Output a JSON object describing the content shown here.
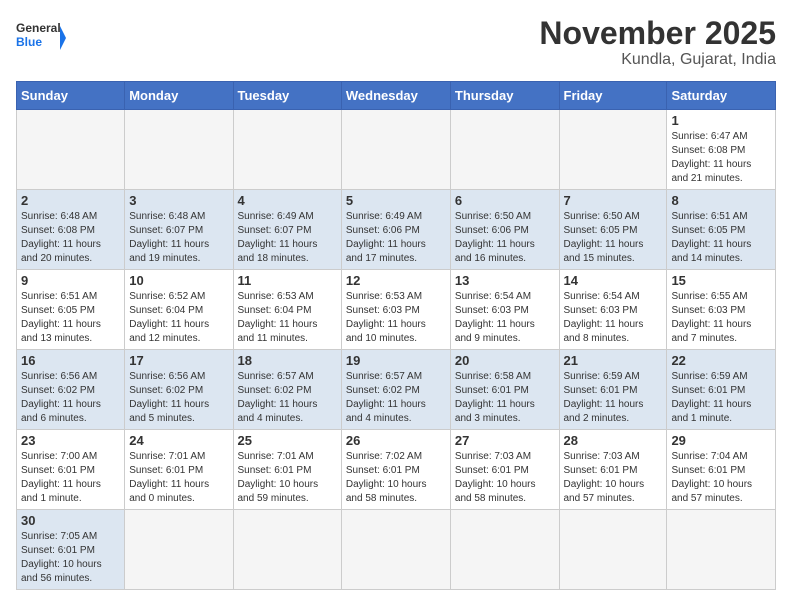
{
  "header": {
    "logo_general": "General",
    "logo_blue": "Blue",
    "month_title": "November 2025",
    "location": "Kundla, Gujarat, India"
  },
  "columns": [
    "Sunday",
    "Monday",
    "Tuesday",
    "Wednesday",
    "Thursday",
    "Friday",
    "Saturday"
  ],
  "weeks": [
    {
      "days": [
        {
          "num": "",
          "info": ""
        },
        {
          "num": "",
          "info": ""
        },
        {
          "num": "",
          "info": ""
        },
        {
          "num": "",
          "info": ""
        },
        {
          "num": "",
          "info": ""
        },
        {
          "num": "",
          "info": ""
        },
        {
          "num": "1",
          "info": "Sunrise: 6:47 AM\nSunset: 6:08 PM\nDaylight: 11 hours\nand 21 minutes."
        }
      ]
    },
    {
      "days": [
        {
          "num": "2",
          "info": "Sunrise: 6:48 AM\nSunset: 6:08 PM\nDaylight: 11 hours\nand 20 minutes."
        },
        {
          "num": "3",
          "info": "Sunrise: 6:48 AM\nSunset: 6:07 PM\nDaylight: 11 hours\nand 19 minutes."
        },
        {
          "num": "4",
          "info": "Sunrise: 6:49 AM\nSunset: 6:07 PM\nDaylight: 11 hours\nand 18 minutes."
        },
        {
          "num": "5",
          "info": "Sunrise: 6:49 AM\nSunset: 6:06 PM\nDaylight: 11 hours\nand 17 minutes."
        },
        {
          "num": "6",
          "info": "Sunrise: 6:50 AM\nSunset: 6:06 PM\nDaylight: 11 hours\nand 16 minutes."
        },
        {
          "num": "7",
          "info": "Sunrise: 6:50 AM\nSunset: 6:05 PM\nDaylight: 11 hours\nand 15 minutes."
        },
        {
          "num": "8",
          "info": "Sunrise: 6:51 AM\nSunset: 6:05 PM\nDaylight: 11 hours\nand 14 minutes."
        }
      ]
    },
    {
      "days": [
        {
          "num": "9",
          "info": "Sunrise: 6:51 AM\nSunset: 6:05 PM\nDaylight: 11 hours\nand 13 minutes."
        },
        {
          "num": "10",
          "info": "Sunrise: 6:52 AM\nSunset: 6:04 PM\nDaylight: 11 hours\nand 12 minutes."
        },
        {
          "num": "11",
          "info": "Sunrise: 6:53 AM\nSunset: 6:04 PM\nDaylight: 11 hours\nand 11 minutes."
        },
        {
          "num": "12",
          "info": "Sunrise: 6:53 AM\nSunset: 6:03 PM\nDaylight: 11 hours\nand 10 minutes."
        },
        {
          "num": "13",
          "info": "Sunrise: 6:54 AM\nSunset: 6:03 PM\nDaylight: 11 hours\nand 9 minutes."
        },
        {
          "num": "14",
          "info": "Sunrise: 6:54 AM\nSunset: 6:03 PM\nDaylight: 11 hours\nand 8 minutes."
        },
        {
          "num": "15",
          "info": "Sunrise: 6:55 AM\nSunset: 6:03 PM\nDaylight: 11 hours\nand 7 minutes."
        }
      ]
    },
    {
      "days": [
        {
          "num": "16",
          "info": "Sunrise: 6:56 AM\nSunset: 6:02 PM\nDaylight: 11 hours\nand 6 minutes."
        },
        {
          "num": "17",
          "info": "Sunrise: 6:56 AM\nSunset: 6:02 PM\nDaylight: 11 hours\nand 5 minutes."
        },
        {
          "num": "18",
          "info": "Sunrise: 6:57 AM\nSunset: 6:02 PM\nDaylight: 11 hours\nand 4 minutes."
        },
        {
          "num": "19",
          "info": "Sunrise: 6:57 AM\nSunset: 6:02 PM\nDaylight: 11 hours\nand 4 minutes."
        },
        {
          "num": "20",
          "info": "Sunrise: 6:58 AM\nSunset: 6:01 PM\nDaylight: 11 hours\nand 3 minutes."
        },
        {
          "num": "21",
          "info": "Sunrise: 6:59 AM\nSunset: 6:01 PM\nDaylight: 11 hours\nand 2 minutes."
        },
        {
          "num": "22",
          "info": "Sunrise: 6:59 AM\nSunset: 6:01 PM\nDaylight: 11 hours\nand 1 minute."
        }
      ]
    },
    {
      "days": [
        {
          "num": "23",
          "info": "Sunrise: 7:00 AM\nSunset: 6:01 PM\nDaylight: 11 hours\nand 1 minute."
        },
        {
          "num": "24",
          "info": "Sunrise: 7:01 AM\nSunset: 6:01 PM\nDaylight: 11 hours\nand 0 minutes."
        },
        {
          "num": "25",
          "info": "Sunrise: 7:01 AM\nSunset: 6:01 PM\nDaylight: 10 hours\nand 59 minutes."
        },
        {
          "num": "26",
          "info": "Sunrise: 7:02 AM\nSunset: 6:01 PM\nDaylight: 10 hours\nand 58 minutes."
        },
        {
          "num": "27",
          "info": "Sunrise: 7:03 AM\nSunset: 6:01 PM\nDaylight: 10 hours\nand 58 minutes."
        },
        {
          "num": "28",
          "info": "Sunrise: 7:03 AM\nSunset: 6:01 PM\nDaylight: 10 hours\nand 57 minutes."
        },
        {
          "num": "29",
          "info": "Sunrise: 7:04 AM\nSunset: 6:01 PM\nDaylight: 10 hours\nand 57 minutes."
        }
      ]
    },
    {
      "days": [
        {
          "num": "30",
          "info": "Sunrise: 7:05 AM\nSunset: 6:01 PM\nDaylight: 10 hours\nand 56 minutes."
        },
        {
          "num": "",
          "info": ""
        },
        {
          "num": "",
          "info": ""
        },
        {
          "num": "",
          "info": ""
        },
        {
          "num": "",
          "info": ""
        },
        {
          "num": "",
          "info": ""
        },
        {
          "num": "",
          "info": ""
        }
      ]
    }
  ]
}
